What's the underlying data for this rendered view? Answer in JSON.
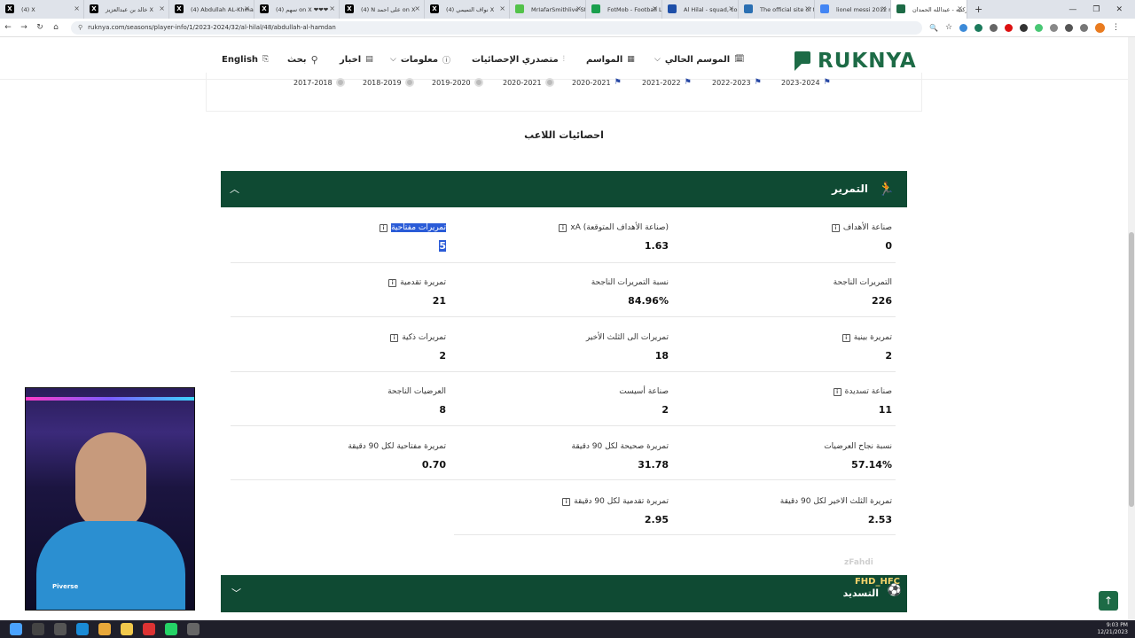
{
  "browser": {
    "tabs": [
      {
        "label": "(4) X",
        "icon": "x-logo-icon",
        "color": "#000000"
      },
      {
        "label": "خالد بن عبدالعزيز X",
        "icon": "x-logo-icon",
        "color": "#000000"
      },
      {
        "label": "(4) Abdullah AL-Khmai",
        "icon": "x-logo-icon",
        "color": "#000000"
      },
      {
        "label": "(4) سهم on X ❤❤❤",
        "icon": "x-logo-icon",
        "color": "#000000"
      },
      {
        "label": "(4) N على احمد on X",
        "icon": "x-logo-icon",
        "color": "#000000"
      },
      {
        "label": "(4) نواف التميمي X",
        "icon": "x-logo-icon",
        "color": "#000000"
      },
      {
        "label": "MrIafarSmithlive Stre",
        "icon": "stream-icon",
        "color": "#53c24a"
      },
      {
        "label": "FotMob - Football Live",
        "icon": "fotmob-icon",
        "color": "#1a9f4d"
      },
      {
        "label": "Al Hilal - squad, coach",
        "icon": "transfermarkt-icon",
        "color": "#1e4fa8"
      },
      {
        "label": "The official site of the",
        "icon": "site-icon",
        "color": "#2a6fb2"
      },
      {
        "label": "lionel messi 2012 mat",
        "icon": "google-icon",
        "color": "#4285f4"
      },
      {
        "label": "ركنيه - عبدالله الحمدان",
        "icon": "ruknya-icon",
        "color": "#1d6b46"
      }
    ],
    "url": "ruknya.com/seasons/player-info/1/2023-2024/32/al-hilal/48/abdullah-al-hamdan",
    "new_tab": "+"
  },
  "header": {
    "logo_text": "RUKNYA",
    "nav": {
      "current_season": "الموسم الحالي",
      "seasons": "المواسم",
      "top_stats": "متصدري الإحصائيات",
      "info": "معلومات",
      "news": "اخبار",
      "search": "بحث",
      "language": "English"
    }
  },
  "season_tabs": [
    {
      "label": "2023-2024",
      "icon": "hilal-icon"
    },
    {
      "label": "2022-2023",
      "icon": "hilal-icon"
    },
    {
      "label": "2021-2022",
      "icon": "hilal-icon"
    },
    {
      "label": "2020-2021",
      "icon": "hilal-icon"
    },
    {
      "label": "2020-2021",
      "icon": "club-icon"
    },
    {
      "label": "2019-2020",
      "icon": "club-icon"
    },
    {
      "label": "2018-2019",
      "icon": "club-icon"
    },
    {
      "label": "2017-2018",
      "icon": "club-icon"
    }
  ],
  "section_title": "احصائيات اللاعب",
  "passing_card": {
    "title": "التمرير",
    "stats": [
      {
        "label": "صناعة الأهداف",
        "value": "0",
        "info": true
      },
      {
        "label": "xA (صناعة الأهداف المتوقعة)",
        "value": "1.63",
        "info": true
      },
      {
        "label": "تمريرات مفتاحية",
        "value": "5",
        "info": true
      },
      {
        "label": "التمريرات الناجحة",
        "value": "226",
        "info": false
      },
      {
        "label": "نسبة التمريرات الناجحة",
        "value": "84.96%",
        "info": false
      },
      {
        "label": "تمريرة تقدمية",
        "value": "21",
        "info": true
      },
      {
        "label": "تمريرة بينية",
        "value": "2",
        "info": true
      },
      {
        "label": "تمريرات الى الثلث الأخير",
        "value": "18",
        "info": false
      },
      {
        "label": "تمريرات ذكية",
        "value": "2",
        "info": true
      },
      {
        "label": "صناعة تسديدة",
        "value": "11",
        "info": true
      },
      {
        "label": "صناعة أسيست",
        "value": "2",
        "info": false
      },
      {
        "label": "العرضيات الناجحة",
        "value": "8",
        "info": false
      },
      {
        "label": "نسبة نجاح العرضيات",
        "value": "57.14%",
        "info": false
      },
      {
        "label": "تمريرة صحيحة لكل 90 دقيقة",
        "value": "31.78",
        "info": false
      },
      {
        "label": "تمريرة مفتاحية لكل 90 دقيقة",
        "value": "0.70",
        "info": false
      },
      {
        "label": "تمريرة الثلث الاخير لكل 90 دقيقة",
        "value": "2.53",
        "info": false
      },
      {
        "label": "تمريرة تقدمية لكل 90 دقيقة",
        "value": "2.95",
        "info": true
      }
    ]
  },
  "shooting_card": {
    "title": "التسديد",
    "tag": "FHD_HFC"
  },
  "overlay": {
    "handle": "zFahdi"
  },
  "webcam": {
    "shirt_text": "Piverse"
  },
  "taskbar": {
    "time": "9:03 PM",
    "date": "12/21/2023"
  },
  "colors": {
    "brand": "#1d6b46",
    "card": "#0f4a33",
    "selection": "#2a5bd7"
  }
}
